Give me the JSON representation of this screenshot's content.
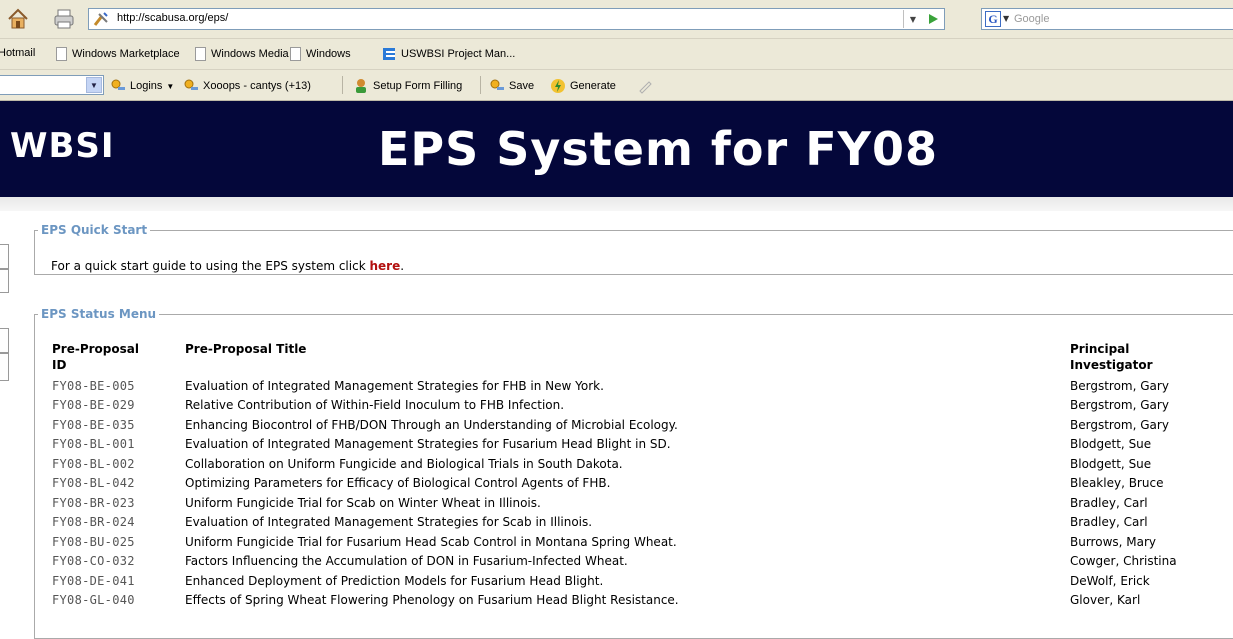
{
  "browser": {
    "url": "http://scabusa.org/eps/",
    "search_placeholder": "Google"
  },
  "bookmarks": [
    {
      "label": "Hotmail"
    },
    {
      "label": "Windows Marketplace"
    },
    {
      "label": "Windows Media"
    },
    {
      "label": "Windows"
    },
    {
      "label": "USWBSI Project Man..."
    }
  ],
  "toolbar": {
    "logins": "Logins",
    "xooops": "Xooops - cantys (+13)",
    "setup": "Setup Form Filling",
    "save": "Save",
    "generate": "Generate"
  },
  "banner": {
    "logo": "WBSI",
    "title": "EPS System for FY08"
  },
  "quick_start": {
    "legend": "EPS Quick Start",
    "text": "For a quick start guide to using the EPS system click ",
    "link": "here",
    "period": "."
  },
  "status_menu": {
    "legend": "EPS Status Menu",
    "headers": {
      "id_line1": "Pre-Proposal",
      "id_line2": "ID",
      "title": "Pre-Proposal Title",
      "pi_line1": "Principal",
      "pi_line2": "Investigator"
    },
    "rows": [
      {
        "id": "FY08-BE-005",
        "title": "Evaluation of Integrated Management Strategies for FHB in New York.",
        "pi": "Bergstrom, Gary"
      },
      {
        "id": "FY08-BE-029",
        "title": "Relative Contribution of Within-Field Inoculum to FHB Infection.",
        "pi": "Bergstrom, Gary"
      },
      {
        "id": "FY08-BE-035",
        "title": "Enhancing Biocontrol of FHB/DON Through an Understanding of Microbial Ecology.",
        "pi": "Bergstrom, Gary"
      },
      {
        "id": "FY08-BL-001",
        "title": "Evaluation of Integrated Management Strategies for Fusarium Head Blight in SD.",
        "pi": "Blodgett, Sue"
      },
      {
        "id": "FY08-BL-002",
        "title": "Collaboration on Uniform Fungicide and Biological Trials in South Dakota.",
        "pi": "Blodgett, Sue"
      },
      {
        "id": "FY08-BL-042",
        "title": "Optimizing Parameters for Efficacy of Biological Control Agents of FHB.",
        "pi": "Bleakley, Bruce"
      },
      {
        "id": "FY08-BR-023",
        "title": "Uniform Fungicide Trial for Scab on Winter Wheat in Illinois.",
        "pi": "Bradley, Carl"
      },
      {
        "id": "FY08-BR-024",
        "title": "Evaluation of Integrated Management Strategies for Scab in Illinois.",
        "pi": "Bradley, Carl"
      },
      {
        "id": "FY08-BU-025",
        "title": "Uniform Fungicide Trial for Fusarium Head Scab Control in Montana Spring Wheat.",
        "pi": "Burrows, Mary"
      },
      {
        "id": "FY08-CO-032",
        "title": "Factors Influencing the Accumulation of DON in Fusarium-Infected Wheat.",
        "pi": "Cowger, Christina"
      },
      {
        "id": "FY08-DE-041",
        "title": "Enhanced Deployment of Prediction Models for Fusarium Head Blight.",
        "pi": "DeWolf, Erick"
      },
      {
        "id": "FY08-GL-040",
        "title": "Effects of Spring Wheat Flowering Phenology on Fusarium Head Blight Resistance.",
        "pi": "Glover, Karl"
      }
    ]
  },
  "colors": {
    "banner_bg": "#04073a",
    "legend": "#6c96c2",
    "link": "#b3100f"
  }
}
